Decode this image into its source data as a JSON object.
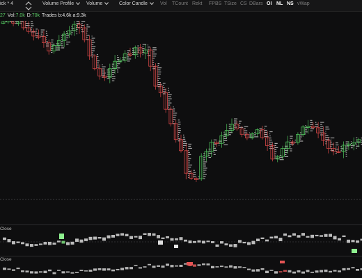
{
  "toolbar": {
    "chart_type": "ick * 4",
    "profile": "Volume Profile",
    "volume": "Volume",
    "candle": "Color Candle",
    "toggles": [
      "Vol",
      "TCount",
      "Rekt",
      "FPBS",
      "TSize",
      "CS",
      "DBars",
      "OI",
      "NL",
      "NS",
      "vWap"
    ],
    "active_toggles": [
      "OI",
      "NL",
      "NS"
    ]
  },
  "info": {
    "prefix": "27",
    "vol_label": "Vol:",
    "vol_value": "7.0k",
    "delta_label": "D:",
    "delta_value": "70k",
    "trades_label": "Trades b:4.6k a:9.3k"
  },
  "panels": {
    "panel1_label": "Close",
    "panel2_label": "Close"
  },
  "colors": {
    "background": "#0e0e0f",
    "up": "#4fc25b",
    "down": "#d64747",
    "dashed": "#3a3a3c"
  }
}
